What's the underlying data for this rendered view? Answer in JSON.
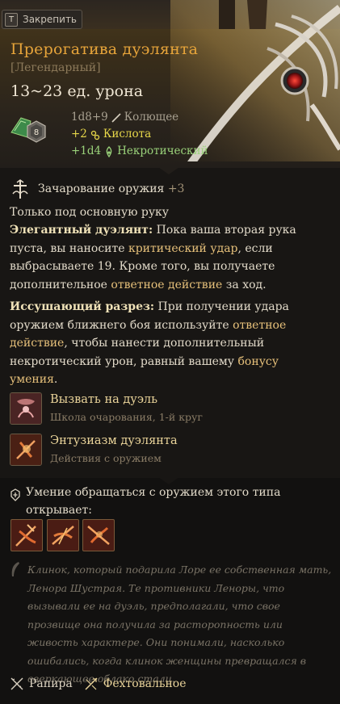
{
  "pin": {
    "key": "T",
    "label": "Закрепить"
  },
  "item": {
    "name": "Прерогатива дуэлянта",
    "rarity": "[Легендарный]",
    "damage": "13~23 ед. урона",
    "enchant_die": "8",
    "damage_rows": [
      {
        "text": "1d8+9",
        "type": "Колющее"
      },
      {
        "text": "+2",
        "type": "Кислота"
      },
      {
        "text": "+1d4",
        "type": "Некротический"
      }
    ]
  },
  "enchant": {
    "title": "Зачарование оружия",
    "bonus": "+3"
  },
  "text": {
    "mainhand": "Только под основную руку",
    "p1_kw": "Элегантный дуэлянт:",
    "p1_a": " Пока ваша вторая рука пуста, вы наносите ",
    "p1_hl1": "критический удар",
    "p1_b": ", если выбрасываете 19. Кроме того, вы получаете дополнительное ",
    "p1_hl2": "ответное действие",
    "p1_c": " за ход.",
    "p2_kw": "Иссушающий разрез:",
    "p2_a": " При получении удара оружием ближнего боя используйте ",
    "p2_hl1": "ответное действие",
    "p2_b": ", чтобы нанести дополнительный некротический урон, равный вашему ",
    "p2_hl2": "бонусу умения",
    "p2_c": "."
  },
  "spells": [
    {
      "name": "Вызвать на дуэль",
      "sub": "Школа очарования, 1-й круг"
    },
    {
      "name": "Энтузиазм дуэлянта",
      "sub": "Действия с оружием"
    }
  ],
  "proficiency": {
    "text": "Умение обращаться с оружием этого типа открывает:"
  },
  "lore": "Клинок, который подарила Лоре ее собственная мать, Ленора Шустрая. Те противники Леноры, что вызывали ее на дуэль, предполагали, что свое прозвище она получила за расторопность или живость характере. Они понимали, насколько ошибались, когда клинок женщины превращался в сверкающее облако стали.",
  "footer": {
    "weapon_type": "Рапира",
    "property": "Фехтовальное"
  },
  "colors": {
    "name": "#e6a43a",
    "highlight": "#e6c07a",
    "acid": "#e8d84a",
    "necrotic": "#9ad27a"
  }
}
